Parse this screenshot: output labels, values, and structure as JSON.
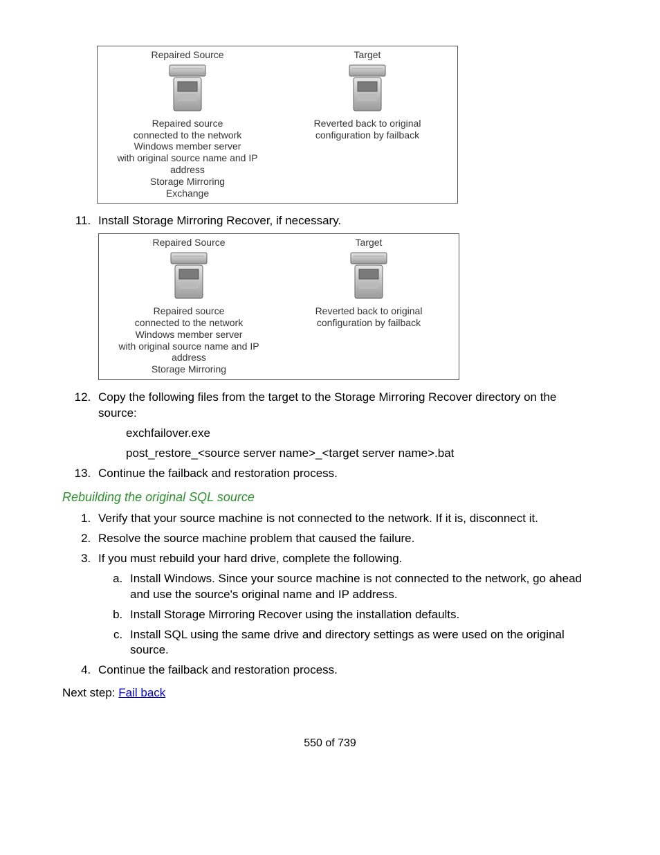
{
  "diagram1": {
    "left_title": "Repaired Source",
    "left_c1": "Repaired source",
    "left_c2": "connected to the network",
    "left_c3": "Windows member server",
    "left_c4": "with original source name and IP address",
    "left_c5": "Storage Mirroring",
    "left_c6": "Exchange",
    "right_title": "Target",
    "right_c1": "Reverted back to original",
    "right_c2": "configuration by failback"
  },
  "step11": "Install Storage Mirroring Recover, if necessary.",
  "diagram2": {
    "left_title": "Repaired Source",
    "left_c1": "Repaired source",
    "left_c2": "connected to the network",
    "left_c3": "Windows member server",
    "left_c4": "with original source name and IP address",
    "left_c5": "Storage Mirroring",
    "right_title": "Target",
    "right_c1": "Reverted back to original",
    "right_c2": "configuration by failback"
  },
  "step12": "Copy the following files from the target to the Storage Mirroring Recover directory on the source:",
  "files": {
    "f1": "exchfailover.exe",
    "f2": "post_restore_<source server name>_<target server name>.bat"
  },
  "step13": "Continue the failback and restoration process.",
  "section_heading": "Rebuilding the original SQL source",
  "sql_steps": {
    "s1": "Verify that your source machine is not connected to the network. If it is, disconnect it.",
    "s2": "Resolve the source machine problem that caused the failure.",
    "s3": "If you must rebuild your hard drive, complete the following.",
    "s3a": "Install Windows. Since your source machine is not connected to the network, go ahead and use the source's original name and IP address.",
    "s3b": "Install Storage Mirroring Recover using the installation defaults.",
    "s3c": "Install SQL using the same drive and directory settings as were used on the original source.",
    "s4": "Continue the failback and restoration process."
  },
  "next_step_label": "Next step: ",
  "next_step_link": "Fail back",
  "page_number": "550 of 739"
}
